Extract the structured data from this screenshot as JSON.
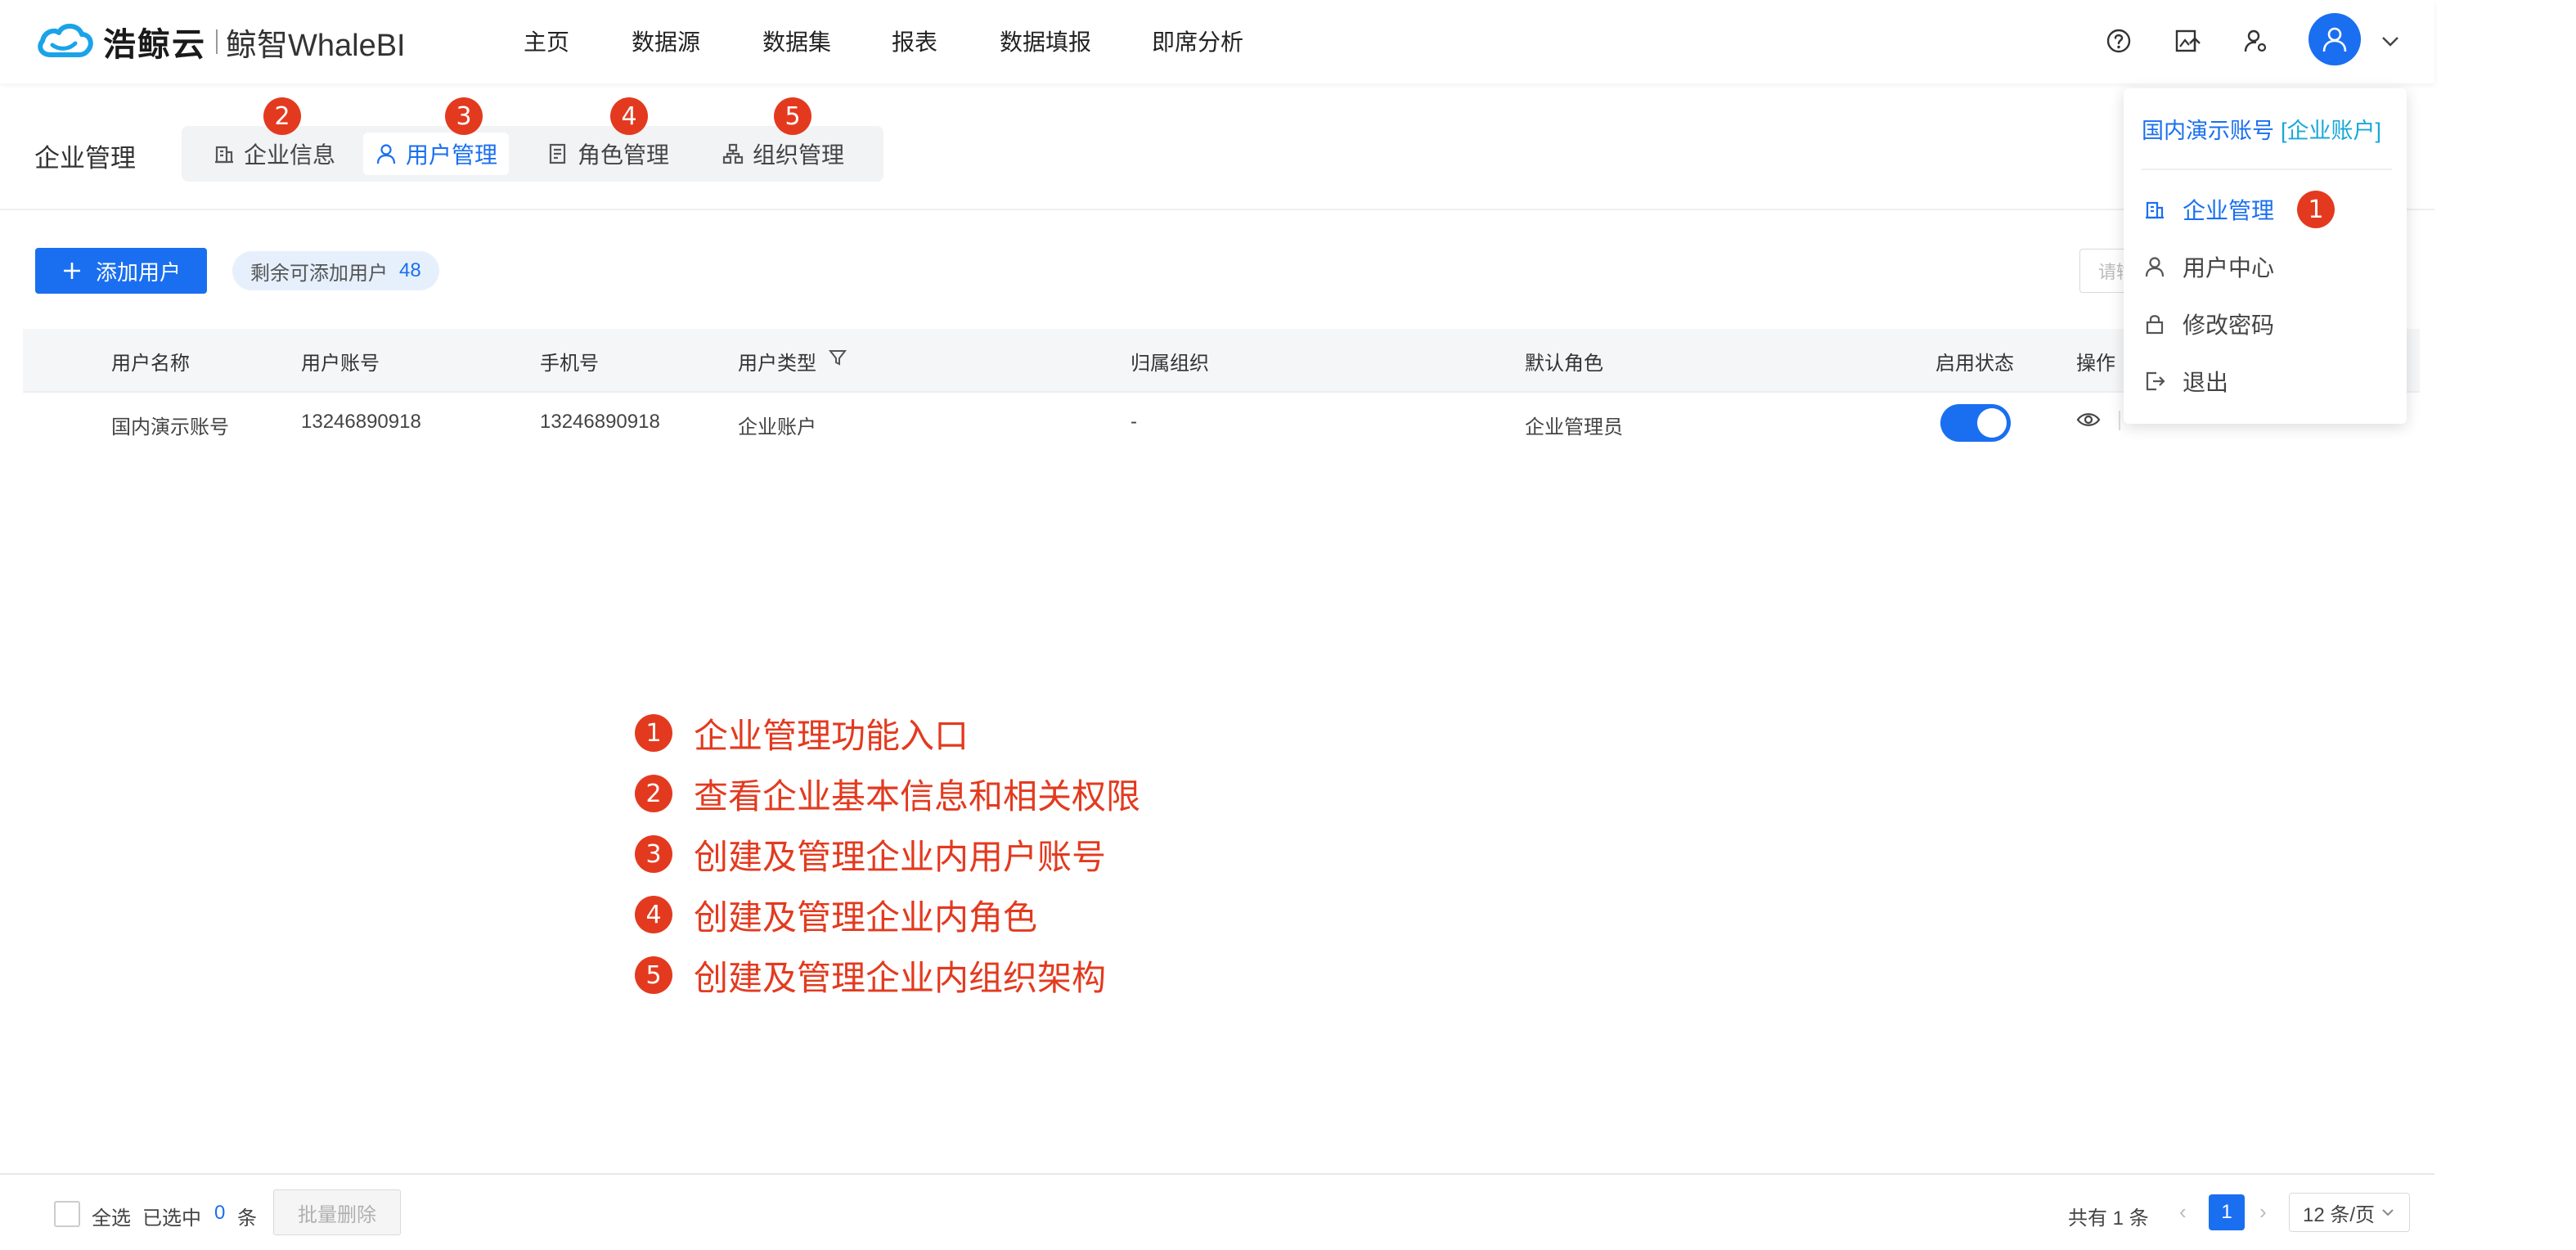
{
  "brand": {
    "name": "浩鲸云",
    "product": "鲸智WhaleBI"
  },
  "nav": {
    "items": [
      "主页",
      "数据源",
      "数据集",
      "报表",
      "数据填报",
      "即席分析"
    ],
    "icons": [
      "help-icon",
      "image-upload-icon",
      "user-settings-icon"
    ]
  },
  "page": {
    "title": "企业管理",
    "tabs": [
      {
        "label": "企业信息",
        "badge": "2",
        "icon": "building-icon"
      },
      {
        "label": "用户管理",
        "badge": "3",
        "icon": "user-icon",
        "active": true
      },
      {
        "label": "角色管理",
        "badge": "4",
        "icon": "role-doc-icon"
      },
      {
        "label": "组织管理",
        "badge": "5",
        "icon": "org-tree-icon"
      }
    ]
  },
  "toolbar": {
    "add_label": "添加用户",
    "remain_label": "剩余可添加用户",
    "remain_count": "48",
    "search_placeholder": "请输"
  },
  "table": {
    "headers": [
      "用户名称",
      "用户账号",
      "手机号",
      "用户类型",
      "归属组织",
      "默认角色",
      "启用状态",
      "操作"
    ],
    "rows": [
      {
        "name": "国内演示账号",
        "account": "13246890918",
        "phone": "13246890918",
        "type": "企业账户",
        "org": "-",
        "role": "默认角色",
        "role_value": "企业管理员",
        "enabled": true
      }
    ]
  },
  "annotations": [
    {
      "num": "1",
      "text": "企业管理功能入口"
    },
    {
      "num": "2",
      "text": "查看企业基本信息和相关权限"
    },
    {
      "num": "3",
      "text": "创建及管理企业内用户账号"
    },
    {
      "num": "4",
      "text": "创建及管理企业内角色"
    },
    {
      "num": "5",
      "text": "创建及管理企业内组织架构"
    }
  ],
  "footer": {
    "select_all": "全选",
    "selected_prefix": "已选中",
    "selected_count": "0",
    "selected_suffix": "条",
    "bulk_delete": "批量删除",
    "total": "共有 1 条",
    "current_page": "1",
    "page_size": "12 条/页"
  },
  "dropdown": {
    "account_name": "国内演示账号",
    "account_type": "[企业账户]",
    "items": [
      {
        "label": "企业管理",
        "icon": "building-icon",
        "badge": "1",
        "active": true
      },
      {
        "label": "用户中心",
        "icon": "user-icon"
      },
      {
        "label": "修改密码",
        "icon": "lock-icon"
      },
      {
        "label": "退出",
        "icon": "logout-icon"
      }
    ]
  },
  "colors": {
    "primary": "#1a6ff0",
    "annotation": "#e33a1f",
    "account_type": "#18a8d8"
  }
}
